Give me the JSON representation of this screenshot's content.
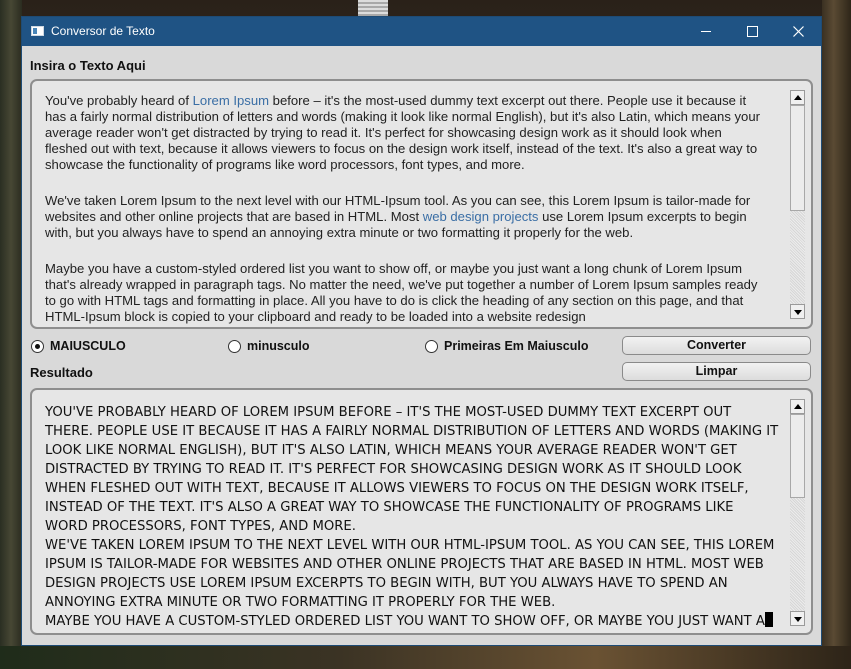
{
  "window": {
    "title": "Conversor de Texto",
    "minimize_glyph": "",
    "maximize_glyph": "",
    "close_glyph": ""
  },
  "input_section": {
    "label": "Insira o Texto Aqui",
    "paragraph1": {
      "before_link": "You've probably heard of ",
      "link": "Lorem Ipsum",
      "after_link": " before – it's the most-used dummy text excerpt out there. People use it because it has a fairly normal distribution of letters and words (making it look like normal English), but it's also Latin, which means your average reader won't get distracted by trying to read it. It's perfect for showcasing design work as it should look when fleshed out with text, because it allows viewers to focus on the design work itself, instead of the text. It's also a great way to showcase the functionality of programs like word processors, font types, and more."
    },
    "paragraph2": {
      "before_link": "We've taken Lorem Ipsum to the next level with our HTML-Ipsum tool. As you can see, this Lorem Ipsum is tailor-made for websites and other online projects that are based in HTML. Most ",
      "link": "web design projects",
      "after_link": " use Lorem Ipsum excerpts to begin with, but you always have to spend an annoying extra minute or two formatting it properly for the web."
    },
    "paragraph3": "Maybe you have a custom-styled ordered list you want to show off, or maybe you just want a long chunk of Lorem Ipsum that's already wrapped in paragraph tags. No matter the need, we've put together a number of Lorem Ipsum samples ready to go with HTML tags and formatting in place. All you have to do is click the heading of any section on this page, and that HTML-Ipsum block is copied to your clipboard and ready to be loaded into a website redesign"
  },
  "options": {
    "uppercase_label": "MAIUSCULO",
    "lowercase_label": "minusculo",
    "titlecase_label": "Primeiras Em Maiusculo",
    "selected": "MAIUSCULO"
  },
  "buttons": {
    "convert_label": "Converter",
    "clear_label": "Limpar"
  },
  "result_section": {
    "label": "Resultado",
    "line1": "YOU'VE PROBABLY HEARD OF LOREM IPSUM BEFORE – IT'S THE MOST-USED DUMMY TEXT EXCERPT OUT THERE. PEOPLE USE IT BECAUSE IT HAS A FAIRLY NORMAL DISTRIBUTION OF LETTERS AND WORDS (MAKING IT LOOK LIKE NORMAL ENGLISH), BUT IT'S ALSO LATIN, WHICH MEANS YOUR AVERAGE READER WON'T GET DISTRACTED BY TRYING TO READ IT. IT'S PERFECT FOR SHOWCASING DESIGN WORK AS IT SHOULD LOOK WHEN FLESHED OUT WITH TEXT, BECAUSE IT ALLOWS VIEWERS TO FOCUS ON THE DESIGN WORK ITSELF, INSTEAD OF THE TEXT. IT'S ALSO A GREAT WAY TO SHOWCASE THE FUNCTIONALITY OF PROGRAMS LIKE WORD PROCESSORS, FONT TYPES, AND MORE.",
    "line2": "WE'VE TAKEN LOREM IPSUM TO THE NEXT LEVEL WITH OUR HTML-IPSUM TOOL. AS YOU CAN SEE, THIS LOREM IPSUM IS TAILOR-MADE FOR WEBSITES AND OTHER ONLINE PROJECTS THAT ARE BASED IN HTML. MOST WEB DESIGN PROJECTS USE LOREM IPSUM EXCERPTS TO BEGIN WITH, BUT YOU ALWAYS HAVE TO SPEND AN ANNOYING EXTRA MINUTE OR TWO FORMATTING IT PROPERLY FOR THE WEB.",
    "line3": "MAYBE YOU HAVE A CUSTOM-STYLED ORDERED LIST YOU WANT TO SHOW OFF, OR MAYBE YOU JUST WANT A"
  },
  "colors": {
    "titlebar": "#1f5384",
    "window_bg": "#d9d9d9",
    "link": "#3a6ea5"
  }
}
